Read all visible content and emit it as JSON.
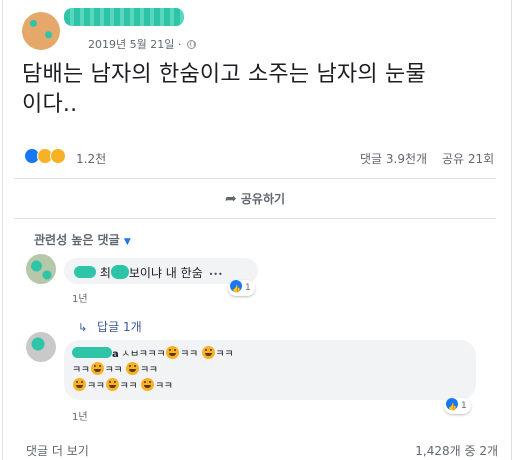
{
  "post": {
    "date": "2019년 5월 21일",
    "dot": "·",
    "text_line1": "담배는 남자의 한숨이고 소주는 남자의 눈물",
    "text_line2": "이다..",
    "reaction_count": "1.2천",
    "comments_count": "댓글 3.9천개",
    "shares_count": "공유 21회"
  },
  "actions": {
    "share_label": "공유하기"
  },
  "comments_section": {
    "sort_label": "관련성 높은 댓글",
    "comment1": {
      "text_start": "최",
      "text_mid": "보이냐 내 한숨",
      "more": "•••",
      "time": "1년",
      "like_count": "1"
    },
    "reply_link": "답글 1개",
    "comment2": {
      "author_tail": "a",
      "line1_a": "ㅅㅂㅋㅋㅋ",
      "line1_b": "ㅋㅋ",
      "line1_c": "ㅋㅋ",
      "line1_d": "ㅋㅋ",
      "line2_a": "ㅋㅋ",
      "line2_b": "ㅋㅋ",
      "line2_c": "ㅋㅋ",
      "line3_a": "ㅋㅋ",
      "line3_b": "ㅋㅋ",
      "time": "1년",
      "like_count": "1"
    },
    "more_comments": "댓글 더 보기",
    "pagination": "1,428개 중 2개"
  },
  "colors": {
    "accent": "#1877f2",
    "text_secondary": "#606770",
    "redaction": "#2ec4a8"
  },
  "icons": [
    "globe-icon",
    "like-reaction-icon",
    "haha-reaction-icon",
    "wow-reaction-icon",
    "share-arrow-icon",
    "dropdown-caret-icon",
    "reply-arrow-icon",
    "more-options-icon",
    "laugh-emoji-icon"
  ]
}
